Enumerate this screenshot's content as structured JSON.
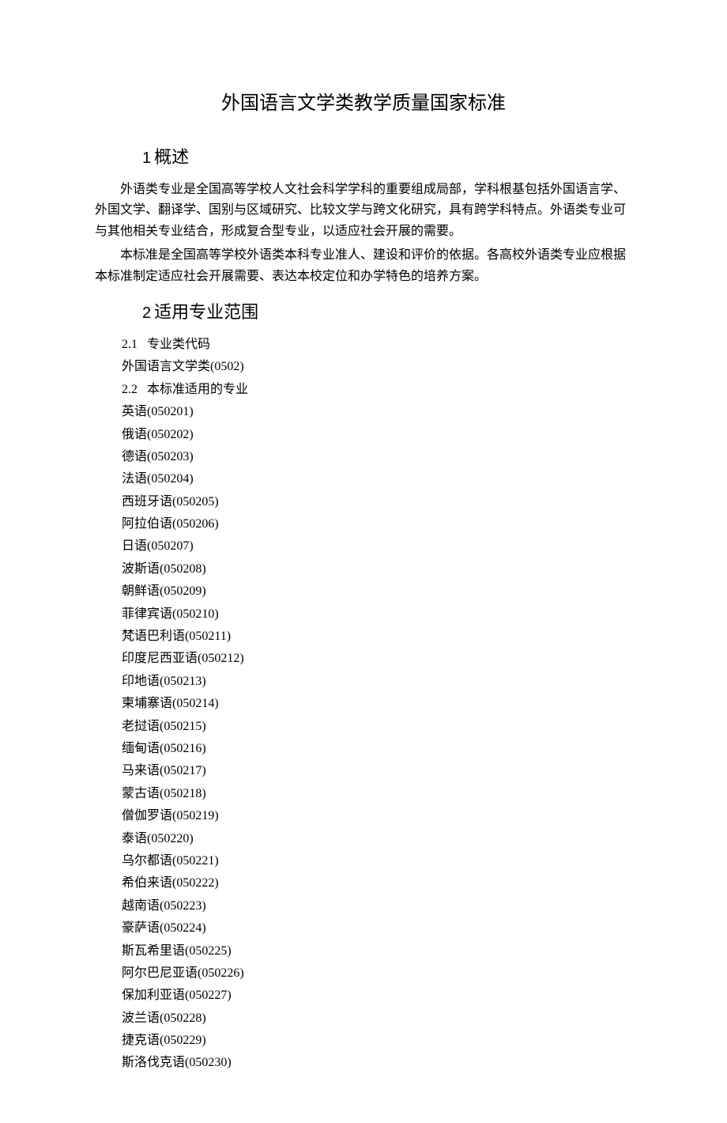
{
  "title": "外国语言文学类教学质量国家标准",
  "section1": {
    "heading_num": "1",
    "heading_text": "概述",
    "p1": "外语类专业是全国高等学校人文社会科学学科的重要组成局部，学科根基包括外国语言学、外国文学、翻译学、国别与区域研究、比较文学与跨文化研究，具有跨学科特点。外语类专业可与其他相关专业结合，形成复合型专业，以适应社会开展的需要。",
    "p2": "本标准是全国高等学校外语类本科专业准人、建设和评价的依据。各高校外语类专业应根据本标准制定适应社会开展需要、表达本校定位和办学特色的培养方案。"
  },
  "section2": {
    "heading_num": "2",
    "heading_text": "适用专业范围",
    "sub1_num": "2.1",
    "sub1_label": "专业类代码",
    "sub1_value": "外国语言文学类(0502)",
    "sub2_num": "2.2",
    "sub2_label": "本标准适用的专业",
    "languages": [
      "英语(050201)",
      "俄语(050202)",
      "德语(050203)",
      "法语(050204)",
      "西班牙语(050205)",
      "阿拉伯语(050206)",
      "日语(050207)",
      "波斯语(050208)",
      "朝鲜语(050209)",
      "菲律宾语(050210)",
      "梵语巴利语(050211)",
      "印度尼西亚语(050212)",
      "印地语(050213)",
      "柬埔寨语(050214)",
      "老挝语(050215)",
      "缅甸语(050216)",
      "马来语(050217)",
      "蒙古语(050218)",
      "僧伽罗语(050219)",
      "泰语(050220)",
      "乌尔都语(050221)",
      "希伯来语(050222)",
      "越南语(050223)",
      "豪萨语(050224)",
      "斯瓦希里语(050225)",
      "阿尔巴尼亚语(050226)",
      "保加利亚语(050227)",
      "波兰语(050228)",
      "捷克语(050229)",
      "斯洛伐克语(050230)"
    ]
  }
}
